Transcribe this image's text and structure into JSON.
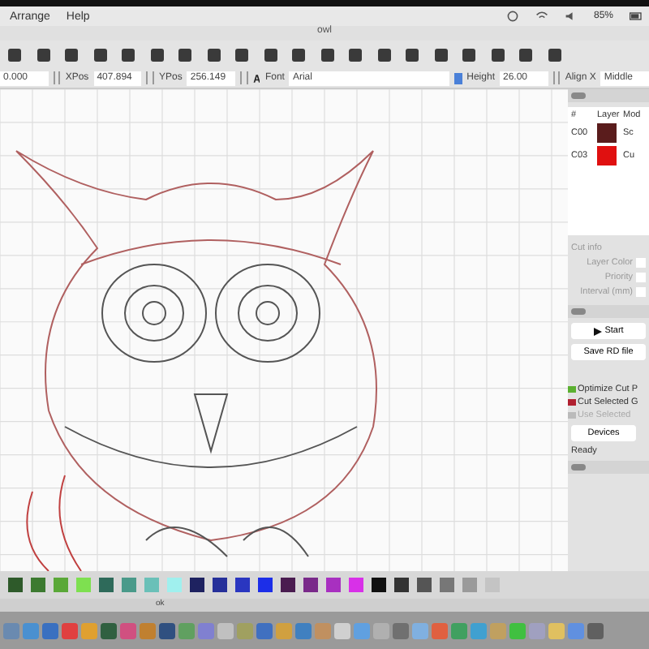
{
  "menu": [
    "Arrange",
    "Help"
  ],
  "battery": "85%",
  "window": {
    "title": "owl"
  },
  "properties": [
    {
      "value": "0.000"
    },
    {
      "label": "XPos",
      "value": "407.894"
    },
    {
      "label": "YPos",
      "value": "256.149"
    },
    {
      "label": "Font",
      "value": "Arial"
    },
    {
      "label": "Height",
      "value": "26.00"
    },
    {
      "label": "Align X",
      "value": "Middle"
    }
  ],
  "layers": {
    "columns": [
      "#",
      "Layer",
      "Mod"
    ],
    "rows": [
      {
        "num": "C00",
        "color": "#5a1c1c",
        "mode": "Sc"
      },
      {
        "num": "C03",
        "color": "#e01010",
        "mode": "Cu"
      }
    ]
  },
  "cut_info": {
    "title": "Cut info",
    "labels": [
      "Layer Color",
      "Priority",
      "Interval (mm)"
    ]
  },
  "buttons": [
    "Start",
    "Save RD file"
  ],
  "options": [
    {
      "label": "Optimize Cut P",
      "checked": true,
      "disabled": false
    },
    {
      "label": "Cut Selected G",
      "checked": true,
      "disabled": false
    },
    {
      "label": "Use Selected",
      "checked": false,
      "disabled": true
    }
  ],
  "devices_button": "Devices",
  "status": "Ready",
  "palette": [
    {
      "color": "#2e5a2a"
    },
    {
      "color": "#3c7a30"
    },
    {
      "color": "#5aa838"
    },
    {
      "color": "#7ee050"
    },
    {
      "color": "#2e6a5a"
    },
    {
      "color": "#4a9a8a"
    },
    {
      "color": "#6ac0b8"
    },
    {
      "color": "#a0f0ee"
    },
    {
      "color": "#1e2260"
    },
    {
      "color": "#26309a"
    },
    {
      "color": "#2a36c0"
    },
    {
      "color": "#1c2ee8"
    },
    {
      "color": "#4a1c50"
    },
    {
      "color": "#7a2a8a"
    },
    {
      "color": "#a830c0"
    },
    {
      "color": "#d830e8"
    },
    {
      "color": "#111111"
    },
    {
      "color": "#333333"
    },
    {
      "color": "#555555"
    },
    {
      "color": "#777777"
    },
    {
      "color": "#9a9a9a"
    },
    {
      "color": "#c4c4c4"
    }
  ],
  "dock_label": "ok"
}
